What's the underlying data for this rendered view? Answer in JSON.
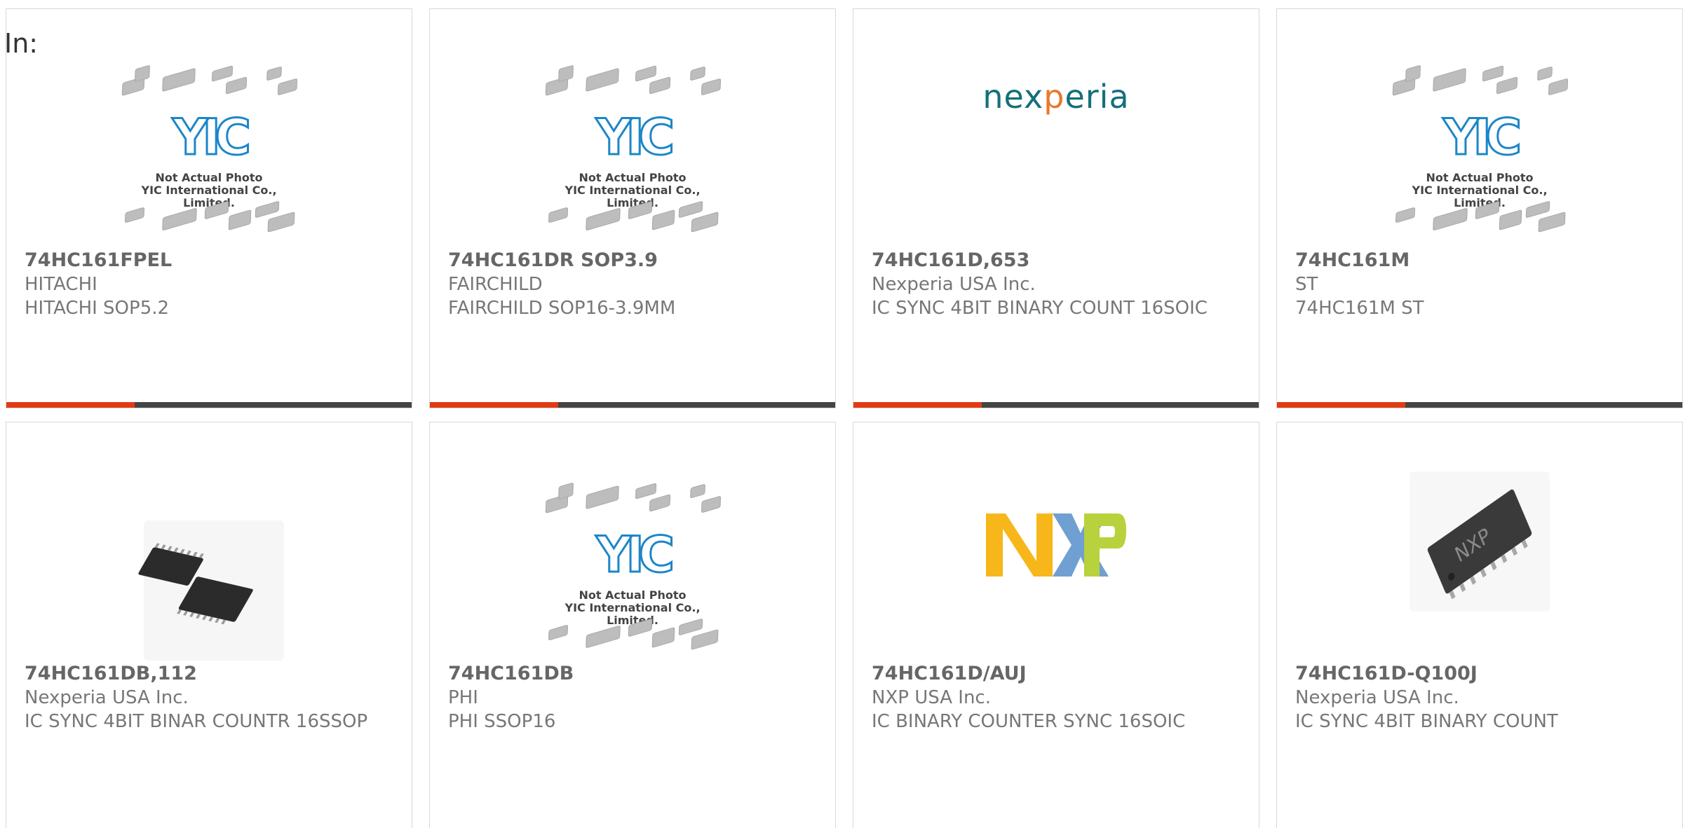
{
  "header": {
    "in_label": "In:"
  },
  "placeholder": {
    "line1": "Not Actual Photo",
    "line2": "YIC International Co., Limited.",
    "logo_text": "YIC"
  },
  "colors": {
    "accent_red": "#e23b14",
    "accent_dark": "#454545",
    "nexperia_teal": "#14707a"
  },
  "products": [
    {
      "part": "74HC161FPEL",
      "manufacturer": "HITACHI",
      "description": "HITACHI SOP5.2",
      "image": "yic-placeholder"
    },
    {
      "part": "74HC161DR SOP3.9",
      "manufacturer": "FAIRCHILD",
      "description": "FAIRCHILD SOP16-3.9MM",
      "image": "yic-placeholder"
    },
    {
      "part": "74HC161D,653",
      "manufacturer": "Nexperia USA Inc.",
      "description": "IC SYNC 4BIT BINARY COUNT 16SOIC",
      "image": "nexperia-logo",
      "logo_text": "nexperia"
    },
    {
      "part": "74HC161M",
      "manufacturer": "ST",
      "description": "74HC161M ST",
      "image": "yic-placeholder"
    },
    {
      "part": "74HC161DB,112",
      "manufacturer": "Nexperia USA Inc.",
      "description": "IC SYNC 4BIT BINAR COUNTR 16SSOP",
      "image": "ssop-chips-photo"
    },
    {
      "part": "74HC161DB",
      "manufacturer": "PHI",
      "description": "PHI SSOP16",
      "image": "yic-placeholder"
    },
    {
      "part": "74HC161D/AUJ",
      "manufacturer": "NXP USA Inc.",
      "description": "IC BINARY COUNTER SYNC 16SOIC",
      "image": "nxp-logo"
    },
    {
      "part": "74HC161D-Q100J",
      "manufacturer": "Nexperia USA Inc.",
      "description": "IC SYNC 4BIT BINARY COUNT",
      "image": "soic-chip-photo"
    }
  ]
}
